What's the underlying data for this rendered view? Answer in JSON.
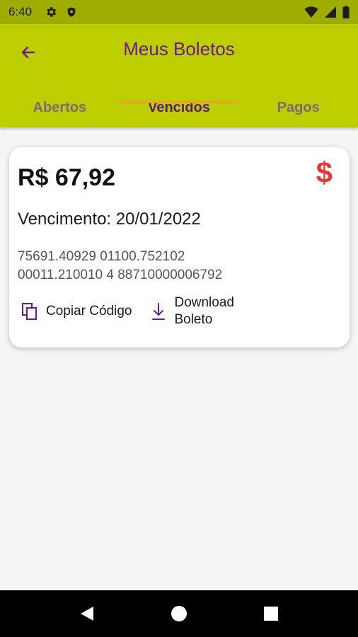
{
  "status_bar": {
    "time": "6:40"
  },
  "app_bar": {
    "title": "Meus Boletos"
  },
  "tabs": [
    {
      "label": "Abertos",
      "active": false
    },
    {
      "label": "Vencidos",
      "active": true
    },
    {
      "label": "Pagos",
      "active": false
    }
  ],
  "boleto": {
    "amount": "R$ 67,92",
    "due_date": "Vencimento: 20/01/2022",
    "barcode_line1": "75691.40929 01100.752102",
    "barcode_line2": "00011.210010 4 88710000006792",
    "copy_label": "Copiar Código",
    "download_label_line1": "Download",
    "download_label_line2": "Boleto"
  },
  "colors": {
    "app_bar": "#bccd00",
    "status_bar": "#9fad00",
    "accent_purple": "#6a1b9a",
    "tab_indicator": "#f0a030",
    "dollar_red": "#e53935"
  },
  "icons": [
    "back-arrow-icon",
    "settings-icon",
    "shield-icon",
    "wifi-icon",
    "signal-icon",
    "battery-icon",
    "dollar-icon",
    "copy-icon",
    "download-icon",
    "nav-back-icon",
    "nav-home-icon",
    "nav-recents-icon"
  ]
}
